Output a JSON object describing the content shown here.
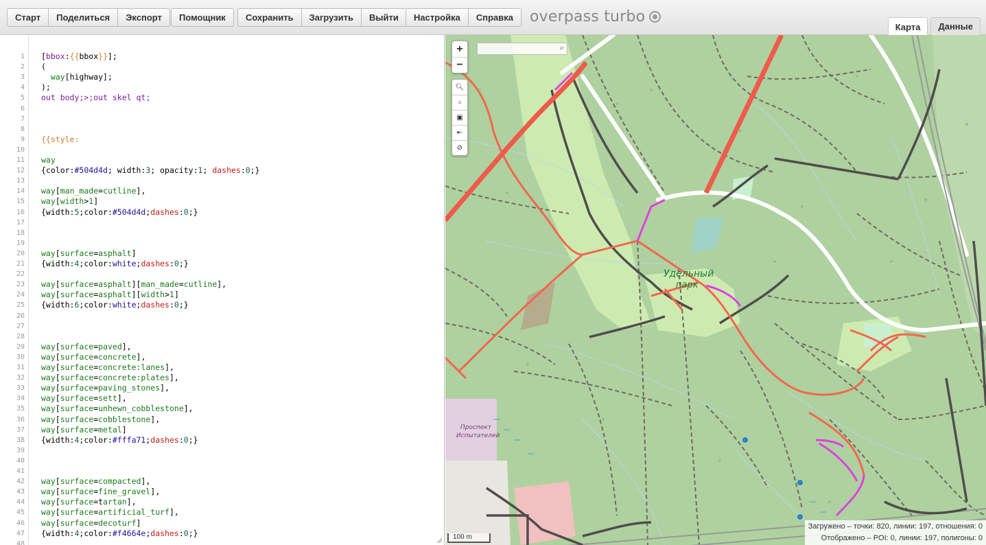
{
  "toolbar": {
    "group1": [
      "Старт",
      "Поделиться",
      "Экспорт"
    ],
    "group2": [
      "Помощник"
    ],
    "group3": [
      "Сохранить",
      "Загрузить",
      "Выйти"
    ],
    "group4": [
      "Настройка",
      "Справка"
    ],
    "app_title": "overpass turbo"
  },
  "tabs": {
    "map": "Карта",
    "data": "Данные"
  },
  "editor": {
    "lines": [
      "[bbox:{{bbox}}];",
      "(",
      "  way[highway];",
      ");",
      "out body;>;out skel qt;",
      "",
      "",
      "",
      "{{style:",
      "",
      "way",
      "{color:#504d4d; width:3; opacity:1; dashes:0;}",
      "",
      "way[man_made=cutline],",
      "way[width>1]",
      "{width:5;color:#504d4d;dashes:0;}",
      "",
      "",
      "",
      "way[surface=asphalt]",
      "{width:4;color:white;dashes:0;}",
      "",
      "way[surface=asphalt][man_made=cutline],",
      "way[surface=asphalt][width>1]",
      "{width:6;color:white;dashes:0;}",
      "",
      "",
      "",
      "way[surface=paved],",
      "way[surface=concrete],",
      "way[surface=concrete:lanes],",
      "way[surface=concrete:plates],",
      "way[surface=paving_stones],",
      "way[surface=sett],",
      "way[surface=unhewn_cobblestone],",
      "way[surface=cobblestone],",
      "way[surface=metal]",
      "{width:4;color:#fffa71;dashes:0;}",
      "",
      "",
      "",
      "way[surface=compacted],",
      "way[surface=fine_gravel],",
      "way[surface=tartan],",
      "way[surface=artificial_turf],",
      "way[surface=decoturf]",
      "{width:4;color:#f4664e;dashes:0;}",
      ""
    ]
  },
  "map": {
    "zoom_in": "+",
    "zoom_out": "−",
    "tools": [
      "search-icon",
      "locate-icon",
      "image-icon",
      "fit-icon",
      "clear-icon"
    ],
    "labels": {
      "park_line1": "Удельный",
      "park_line2": "парк",
      "metro_line1": "Проспект",
      "metro_line2": "Испытателей"
    },
    "scale": "100 m",
    "stats_loaded": "Загружено – точки: 820, линии: 197, отношения: 0",
    "stats_shown": "Отображено – POI: 0, линии: 197, полигоны: 0"
  },
  "colors": {
    "forest": "#aed19f",
    "meadow": "#cdebb0",
    "road_red": "#f4664e",
    "road_dark": "#504d4d",
    "road_magenta": "#e040e0",
    "road_white": "#ffffff"
  }
}
